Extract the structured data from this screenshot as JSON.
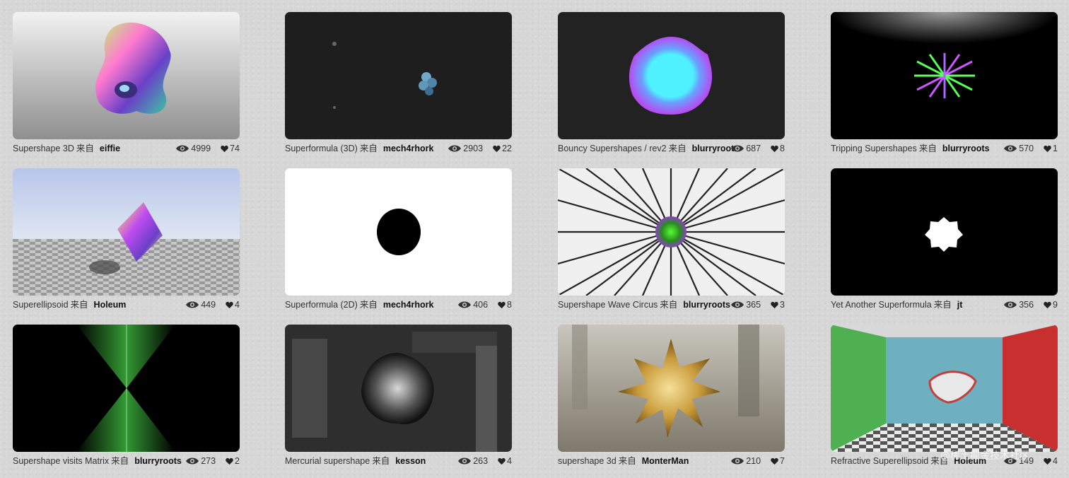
{
  "cards": [
    {
      "title": "Supershape 3D",
      "from": "来自",
      "author": "eiffie",
      "views": "4999",
      "likes": "74"
    },
    {
      "title": "Superformula (3D)",
      "from": "来自",
      "author": "mech4rhork",
      "views": "2903",
      "likes": "22"
    },
    {
      "title": "Bouncy Supershapes / rev2",
      "from": "来自",
      "author": "blurryroots",
      "views": "687",
      "likes": "8"
    },
    {
      "title": "Tripping Supershapes",
      "from": "来自",
      "author": "blurryroots",
      "views": "570",
      "likes": "1"
    },
    {
      "title": "Superellipsoid",
      "from": "来自",
      "author": "Holeum",
      "views": "449",
      "likes": "4"
    },
    {
      "title": "Superformula (2D)",
      "from": "来自",
      "author": "mech4rhork",
      "views": "406",
      "likes": "8"
    },
    {
      "title": "Supershape Wave Circus",
      "from": "来自",
      "author": "blurryroots",
      "views": "365",
      "likes": "3"
    },
    {
      "title": "Yet Another Superformula",
      "from": "来自",
      "author": "jt",
      "views": "356",
      "likes": "9"
    },
    {
      "title": "Supershape visits Matrix",
      "from": "来自",
      "author": "blurryroots",
      "views": "273",
      "likes": "2"
    },
    {
      "title": "Mercurial supershape",
      "from": "来自",
      "author": "kesson",
      "views": "263",
      "likes": "4"
    },
    {
      "title": "supershape 3d",
      "from": "来自",
      "author": "MonterMan",
      "views": "210",
      "likes": "7"
    },
    {
      "title": "Refractive Superellipsoid",
      "from": "来自",
      "author": "Holeum",
      "views": "149",
      "likes": "4"
    }
  ],
  "watermark": "@稀土掘金技术社区",
  "icons": {
    "views": "eye-icon",
    "likes": "heart-icon"
  }
}
